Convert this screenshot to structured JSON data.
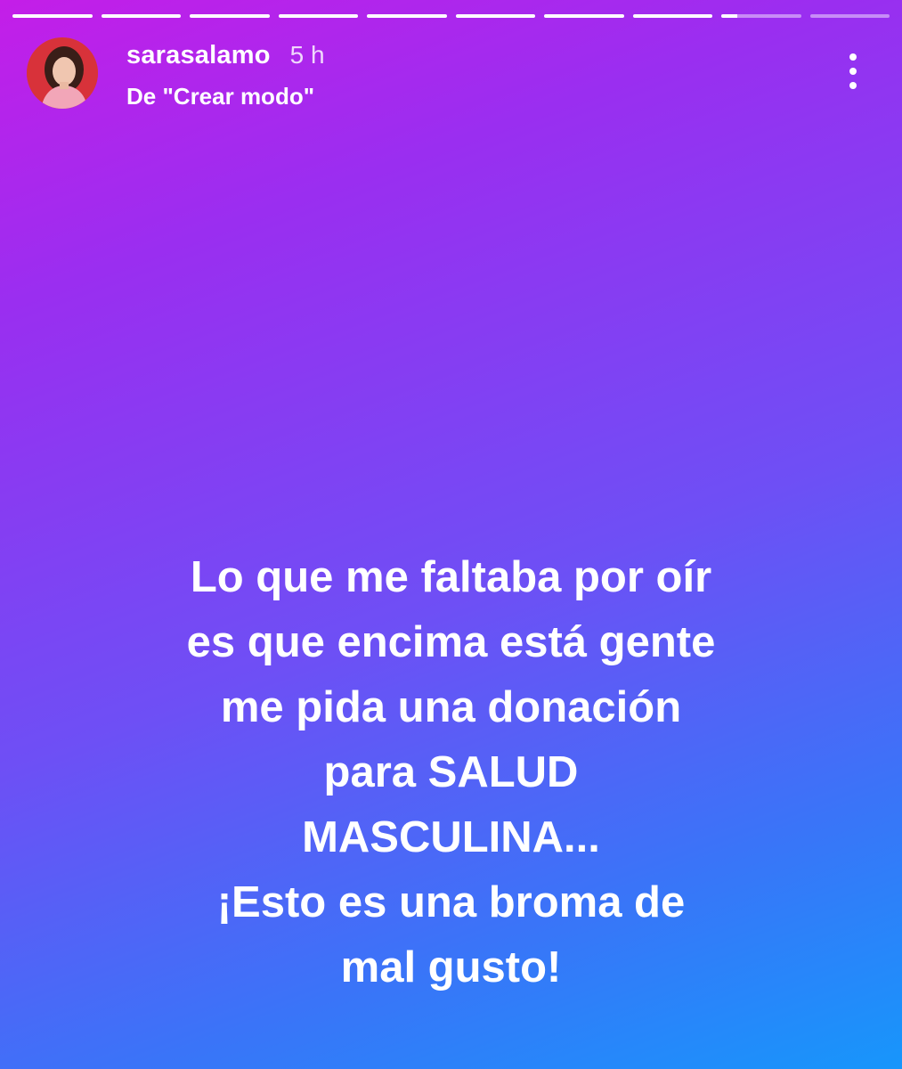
{
  "progress": {
    "segments": [
      1,
      1,
      1,
      1,
      1,
      1,
      1,
      1,
      0.2,
      0
    ]
  },
  "header": {
    "username": "sarasalamo",
    "time": "5 h",
    "subtitle": "De \"Crear modo\""
  },
  "icons": {
    "more": "more-vertical-icon"
  },
  "message": {
    "lines": [
      "Lo que me faltaba por oír",
      "es que encima está gente",
      "me pida una donación",
      "para SALUD",
      "MASCULINA...",
      "¡Esto es una broma de",
      "mal gusto!"
    ]
  },
  "colors": {
    "gradient_start": "#c41ee8",
    "gradient_end": "#1796fb",
    "text": "#ffffff"
  }
}
